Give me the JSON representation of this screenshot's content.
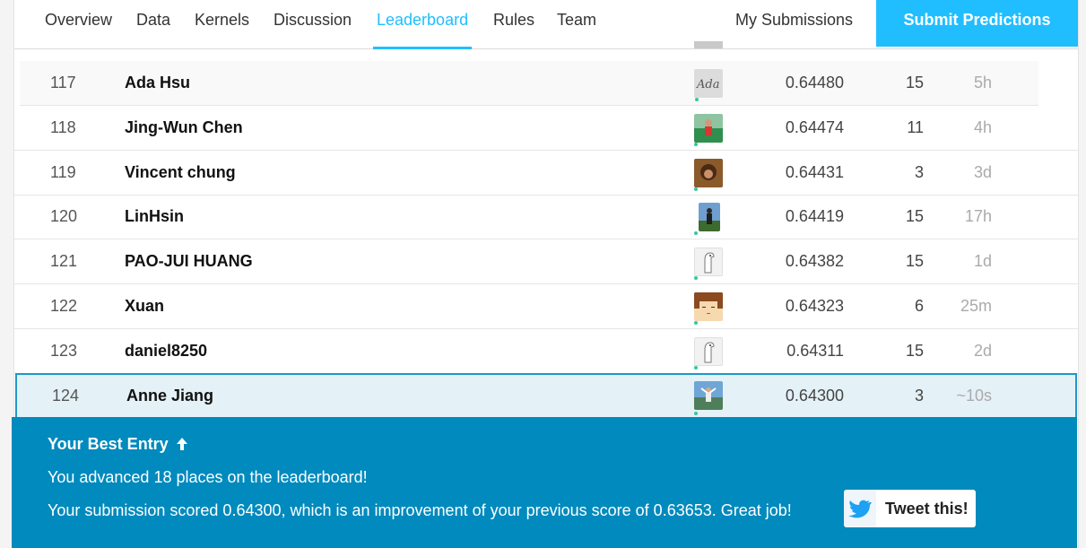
{
  "nav": {
    "tabs": [
      {
        "label": "Overview",
        "active": false
      },
      {
        "label": "Data",
        "active": false
      },
      {
        "label": "Kernels",
        "active": false
      },
      {
        "label": "Discussion",
        "active": false
      },
      {
        "label": "Leaderboard",
        "active": true
      },
      {
        "label": "Rules",
        "active": false
      },
      {
        "label": "Team",
        "active": false
      }
    ],
    "my_submissions": "My Submissions",
    "submit_button": "Submit Predictions"
  },
  "leaderboard": {
    "rows": [
      {
        "rank": "117",
        "team": "Ada Hsu",
        "score": "0.64480",
        "entries": "15",
        "last": "5h",
        "avatar": "ada-signature-avatar"
      },
      {
        "rank": "118",
        "team": "Jing-Wun Chen",
        "score": "0.64474",
        "entries": "11",
        "last": "4h",
        "avatar": "photo-avatar"
      },
      {
        "rank": "119",
        "team": "Vincent chung",
        "score": "0.64431",
        "entries": "3",
        "last": "3d",
        "avatar": "photo-avatar"
      },
      {
        "rank": "120",
        "team": "LinHsin",
        "score": "0.64419",
        "entries": "15",
        "last": "17h",
        "avatar": "photo-avatar"
      },
      {
        "rank": "121",
        "team": "PAO-JUI HUANG",
        "score": "0.64382",
        "entries": "15",
        "last": "1d",
        "avatar": "default-goose-avatar"
      },
      {
        "rank": "122",
        "team": "Xuan",
        "score": "0.64323",
        "entries": "6",
        "last": "25m",
        "avatar": "pixel-face-avatar"
      },
      {
        "rank": "123",
        "team": "daniel8250",
        "score": "0.64311",
        "entries": "15",
        "last": "2d",
        "avatar": "default-goose-avatar"
      },
      {
        "rank": "124",
        "team": "Anne Jiang",
        "score": "0.64300",
        "entries": "3",
        "last": "~10s",
        "avatar": "photo-avatar"
      }
    ]
  },
  "best_entry": {
    "title": "Your Best Entry",
    "line1": "You advanced 18 places on the leaderboard!",
    "line2": "Your submission scored 0.64300, which is an improvement of your previous score of 0.63653. Great job!",
    "tweet_label": "Tweet this!"
  },
  "colors": {
    "accent": "#20beff",
    "banner": "#008abd",
    "highlight_border": "#1f97c8",
    "highlight_bg": "#e4f1f7",
    "status_dot": "#37c5a3"
  }
}
